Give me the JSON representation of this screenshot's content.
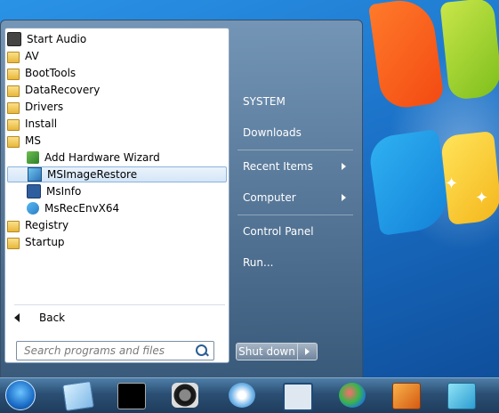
{
  "programs": [
    {
      "label": "Start Audio",
      "icon": "speaker-icon",
      "type": "app"
    },
    {
      "label": "AV",
      "icon": "folder-icon",
      "type": "folder"
    },
    {
      "label": "BootTools",
      "icon": "folder-icon",
      "type": "folder"
    },
    {
      "label": "DataRecovery",
      "icon": "folder-icon",
      "type": "folder"
    },
    {
      "label": "Drivers",
      "icon": "folder-icon",
      "type": "folder"
    },
    {
      "label": "Install",
      "icon": "folder-icon",
      "type": "folder"
    },
    {
      "label": "MS",
      "icon": "folder-icon",
      "type": "folder"
    },
    {
      "label": "Add Hardware Wizard",
      "icon": "wizard-icon",
      "type": "app"
    },
    {
      "label": "MSImageRestore",
      "icon": "image-restore-icon",
      "type": "app",
      "selected": true
    },
    {
      "label": "MsInfo",
      "icon": "msinfo-icon",
      "type": "app"
    },
    {
      "label": "MsRecEnvX64",
      "icon": "recovery-env-icon",
      "type": "app"
    },
    {
      "label": "Registry",
      "icon": "folder-icon",
      "type": "folder"
    },
    {
      "label": "Startup",
      "icon": "folder-icon",
      "type": "folder"
    }
  ],
  "back_label": "Back",
  "search": {
    "placeholder": "Search programs and files"
  },
  "right_pane": {
    "system": "SYSTEM",
    "downloads": "Downloads",
    "recent_items": "Recent Items",
    "computer": "Computer",
    "control_panel": "Control Panel",
    "run": "Run..."
  },
  "shutdown_label": "Shut down",
  "taskbar_icons": [
    "start-orb-icon",
    "notepad-icon",
    "command-prompt-icon",
    "camera-icon",
    "qt-icon",
    "network-diagram-icon",
    "paint-icon",
    "far-manager-icon",
    "sync-icon"
  ]
}
